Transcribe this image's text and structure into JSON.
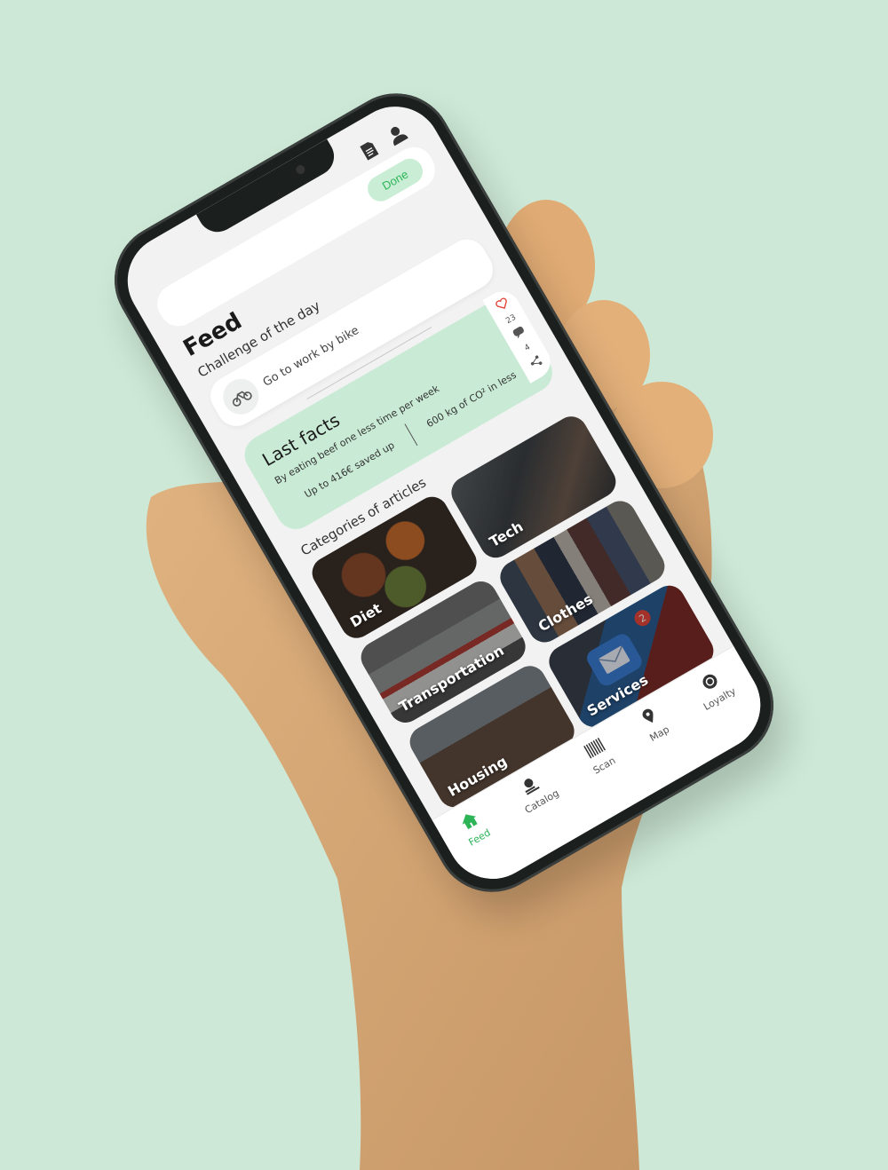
{
  "header": {
    "title": "Feed"
  },
  "challenge": {
    "section_label": "Challenge of the day",
    "text": "Go to work by bike",
    "done_label": "Done"
  },
  "side_actions": {
    "like_count": "23",
    "comment_count": "4"
  },
  "facts": {
    "title": "Last facts",
    "subtitle": "By eating beef one less time per week",
    "money": "Up to 416€ saved up",
    "co2": "600 kg of CO² in less"
  },
  "categories": {
    "label": "Categories of articles",
    "items": [
      {
        "name": "Diet"
      },
      {
        "name": "Tech"
      },
      {
        "name": "Transportation"
      },
      {
        "name": "Clothes"
      },
      {
        "name": "Housing"
      },
      {
        "name": "Services"
      }
    ],
    "services_badge": "2"
  },
  "nav": {
    "items": [
      {
        "label": "Feed",
        "icon": "home-icon",
        "active": true
      },
      {
        "label": "Catalog",
        "icon": "catalog-icon"
      },
      {
        "label": "Scan",
        "icon": "barcode-icon"
      },
      {
        "label": "Map",
        "icon": "map-pin-icon"
      },
      {
        "label": "Loyalty",
        "icon": "loyalty-icon"
      }
    ]
  },
  "colors": {
    "accent": "#2db457",
    "accent_soft": "#c9ebd6",
    "background": "#cde8d6"
  }
}
